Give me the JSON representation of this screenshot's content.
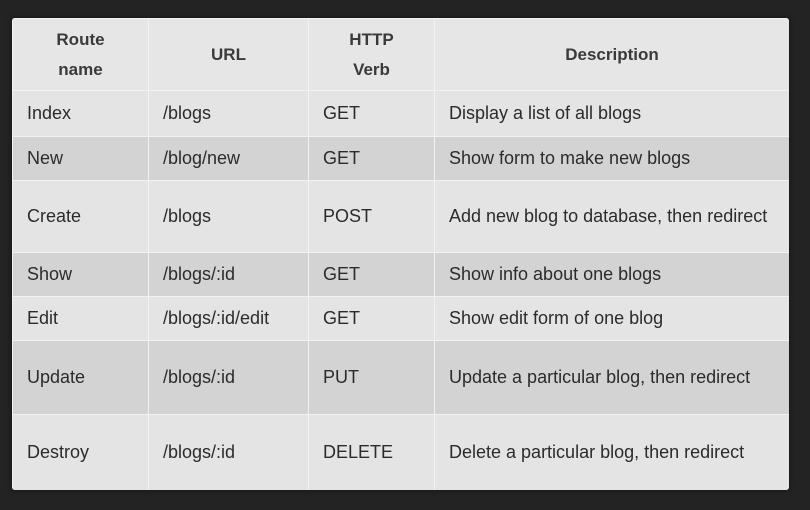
{
  "table": {
    "headers": {
      "route_name": "Route\nname",
      "url": "URL",
      "http_verb": "HTTP\nVerb",
      "description": "Description"
    },
    "rows": [
      {
        "route": "Index",
        "url": "/blogs",
        "verb": "GET",
        "description": "Display a list of all blogs"
      },
      {
        "route": "New",
        "url": "/blog/new",
        "verb": "GET",
        "description": "Show form to make new blogs"
      },
      {
        "route": "Create",
        "url": "/blogs",
        "verb": "POST",
        "description": "Add new blog to database, then redirect"
      },
      {
        "route": "Show",
        "url": "/blogs/:id",
        "verb": "GET",
        "description": "Show info about one blogs"
      },
      {
        "route": "Edit",
        "url": "/blogs/:id/edit",
        "verb": "GET",
        "description": "Show edit form of one blog"
      },
      {
        "route": "Update",
        "url": "/blogs/:id",
        "verb": "PUT",
        "description": "Update a particular blog, then redirect"
      },
      {
        "route": "Destroy",
        "url": "/blogs/:id",
        "verb": "DELETE",
        "description": "Delete a particular blog, then redirect"
      }
    ]
  }
}
